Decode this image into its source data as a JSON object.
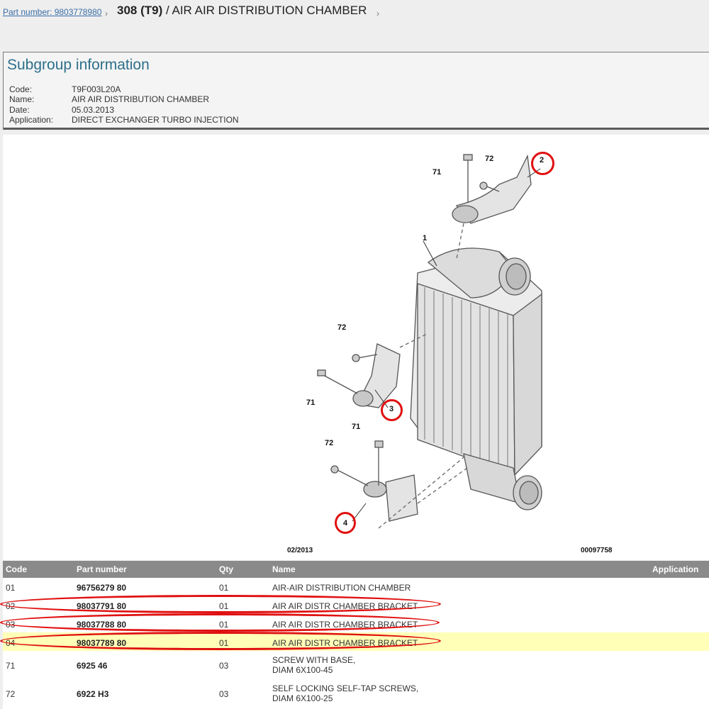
{
  "breadcrumb": {
    "part_link": "Part number: 9803778980",
    "model": "308 (T9)",
    "title": " / AIR AIR DISTRIBUTION CHAMBER"
  },
  "subgroup": {
    "heading": "Subgroup information",
    "fields": [
      {
        "label": "Code:",
        "value": "T9F003L20A"
      },
      {
        "label": "Name:",
        "value": "AIR AIR DISTRIBUTION CHAMBER"
      },
      {
        "label": "Date:",
        "value": "05.03.2013"
      },
      {
        "label": "Application:",
        "value": "DIRECT EXCHANGER TURBO INJECTION"
      }
    ]
  },
  "diagram": {
    "callouts": [
      "1",
      "2",
      "3",
      "4",
      "71",
      "72",
      "71",
      "72",
      "71",
      "72"
    ],
    "date": "02/2013",
    "ref": "00097758",
    "highlight_color": "#e01010"
  },
  "table": {
    "headers": {
      "code": "Code",
      "part": "Part number",
      "qty": "Qty",
      "name": "Name",
      "application": "Application"
    },
    "rows": [
      {
        "code": "01",
        "part": "96756279 80",
        "qty": "01",
        "name": "AIR-AIR DISTRIBUTION CHAMBER",
        "name2": ""
      },
      {
        "code": "02",
        "part": "98037791 80",
        "qty": "01",
        "name": "AIR AIR DISTR CHAMBER BRACKET",
        "name2": ""
      },
      {
        "code": "03",
        "part": "98037788 80",
        "qty": "01",
        "name": "AIR AIR DISTR CHAMBER BRACKET",
        "name2": ""
      },
      {
        "code": "04",
        "part": "98037789 80",
        "qty": "01",
        "name": "AIR AIR DISTR CHAMBER BRACKET",
        "name2": ""
      },
      {
        "code": "71",
        "part": "6925 46",
        "qty": "03",
        "name": "SCREW WITH BASE,",
        "name2": "DIAM 6X100-45"
      },
      {
        "code": "72",
        "part": "6922 H3",
        "qty": "03",
        "name": "SELF LOCKING SELF-TAP SCREWS,",
        "name2": "DIAM 6X100-25"
      }
    ],
    "highlight_row_color": "#ffffb8"
  }
}
